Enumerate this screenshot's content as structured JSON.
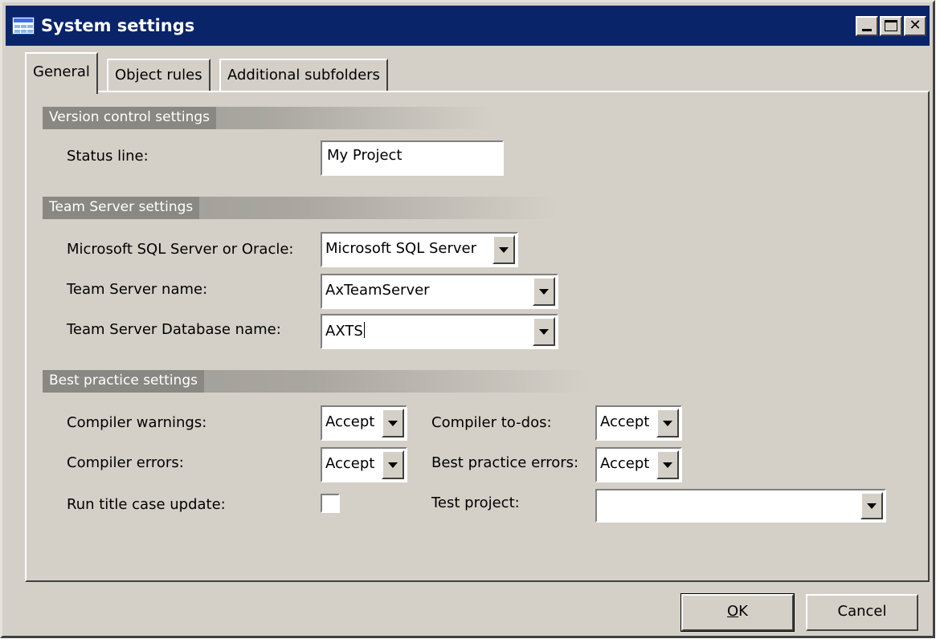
{
  "window": {
    "title": "System settings"
  },
  "tabs": [
    {
      "label": "General",
      "active": true
    },
    {
      "label": "Object rules",
      "active": false
    },
    {
      "label": "Additional subfolders",
      "active": false
    }
  ],
  "version_control": {
    "header": "Version control settings",
    "status_line_label": "Status line:",
    "status_line_value": "My Project"
  },
  "team_server": {
    "header": "Team Server settings",
    "db_type_label": "Microsoft SQL Server or Oracle:",
    "db_type_value": "Microsoft SQL Server",
    "server_name_label": "Team Server name:",
    "server_name_value": "AxTeamServer",
    "db_name_label": "Team Server Database name:",
    "db_name_value": "AXTS"
  },
  "best_practice": {
    "header": "Best practice settings",
    "compiler_warnings_label": "Compiler warnings:",
    "compiler_warnings_value": "Accept",
    "compiler_todos_label": "Compiler to-dos:",
    "compiler_todos_value": "Accept",
    "compiler_errors_label": "Compiler errors:",
    "compiler_errors_value": "Accept",
    "bp_errors_label": "Best practice errors:",
    "bp_errors_value": "Accept",
    "title_case_label": "Run title case update:",
    "title_case_checked": false,
    "test_project_label": "Test project:",
    "test_project_value": ""
  },
  "buttons": {
    "ok_mnemonic": "O",
    "ok_rest": "K",
    "cancel": "Cancel"
  }
}
